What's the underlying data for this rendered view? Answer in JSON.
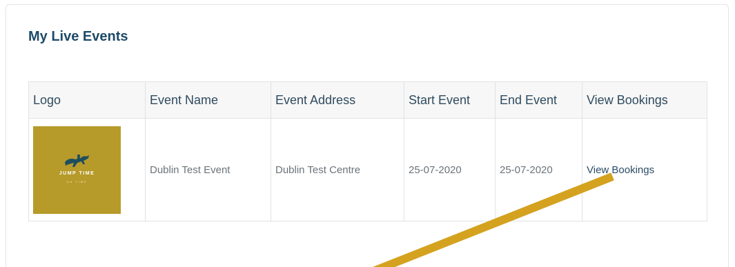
{
  "panel": {
    "title": "My Live Events"
  },
  "table": {
    "headers": [
      "Logo",
      "Event Name",
      "Event Address",
      "Start Event",
      "End Event",
      "View Bookings"
    ],
    "rows": [
      {
        "logo": {
          "line1": "JUMP TIME",
          "line2": "ON TIME",
          "background": "#b69a2a"
        },
        "event_name": "Dublin Test Event",
        "event_address": "Dublin Test Centre",
        "start_event": "25-07-2020",
        "end_event": "25-07-2020",
        "view_bookings": "View Bookings"
      }
    ]
  },
  "annotation": {
    "arrow_color": "#d4a21f",
    "icon": "arrow-annotation"
  }
}
